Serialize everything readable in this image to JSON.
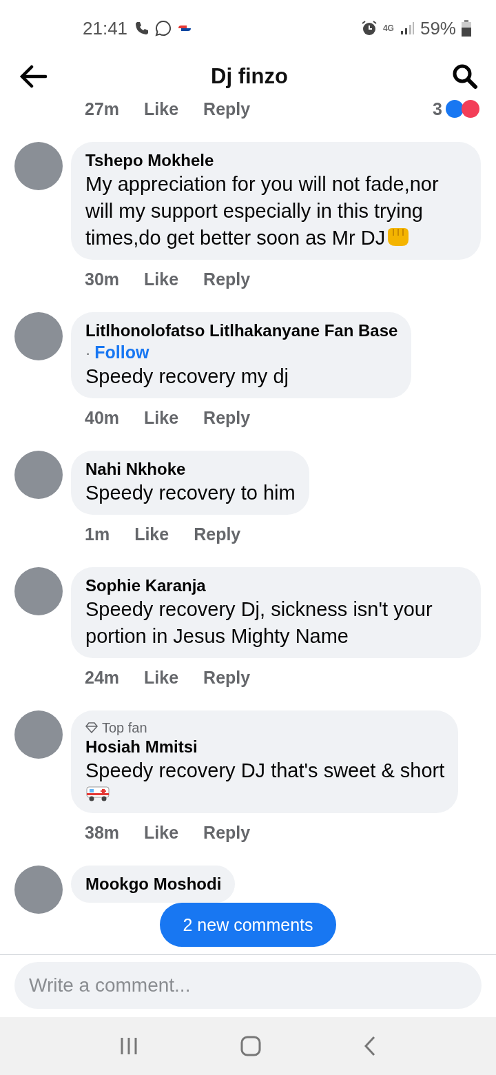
{
  "status_bar": {
    "time": "21:41",
    "battery": "59%",
    "network": "4G"
  },
  "header": {
    "title": "Dj finzo"
  },
  "previous_actions": {
    "time": "27m",
    "like": "Like",
    "reply": "Reply",
    "reactions_count": "3"
  },
  "comments": [
    {
      "name": "Tshepo Mokhele",
      "text": "My appreciation for you will not fade,nor will my support especially in this trying times,do get better soon as Mr DJ",
      "fist_emoji": true,
      "time": "30m",
      "like": "Like",
      "reply": "Reply"
    },
    {
      "name": "Litlhonolofatso Litlhakanyane Fan Base",
      "follow_separator": "·",
      "follow": "Follow",
      "text": "Speedy recovery my dj",
      "time": "40m",
      "like": "Like",
      "reply": "Reply"
    },
    {
      "name": "Nahi Nkhoke",
      "text": "Speedy recovery to him",
      "time": "1m",
      "like": "Like",
      "reply": "Reply"
    },
    {
      "name": "Sophie Karanja",
      "text": "Speedy recovery Dj, sickness isn't your portion in Jesus Mighty Name",
      "time": "24m",
      "like": "Like",
      "reply": "Reply"
    },
    {
      "badge": "Top fan",
      "name": "Hosiah Mmitsi",
      "text": "Speedy recovery DJ that's sweet & short",
      "ambulance_emoji": true,
      "time": "38m",
      "like": "Like",
      "reply": "Reply"
    },
    {
      "name": "Mookgo Moshodi"
    }
  ],
  "new_comments_button": "2 new comments",
  "composer": {
    "placeholder": "Write a comment..."
  }
}
